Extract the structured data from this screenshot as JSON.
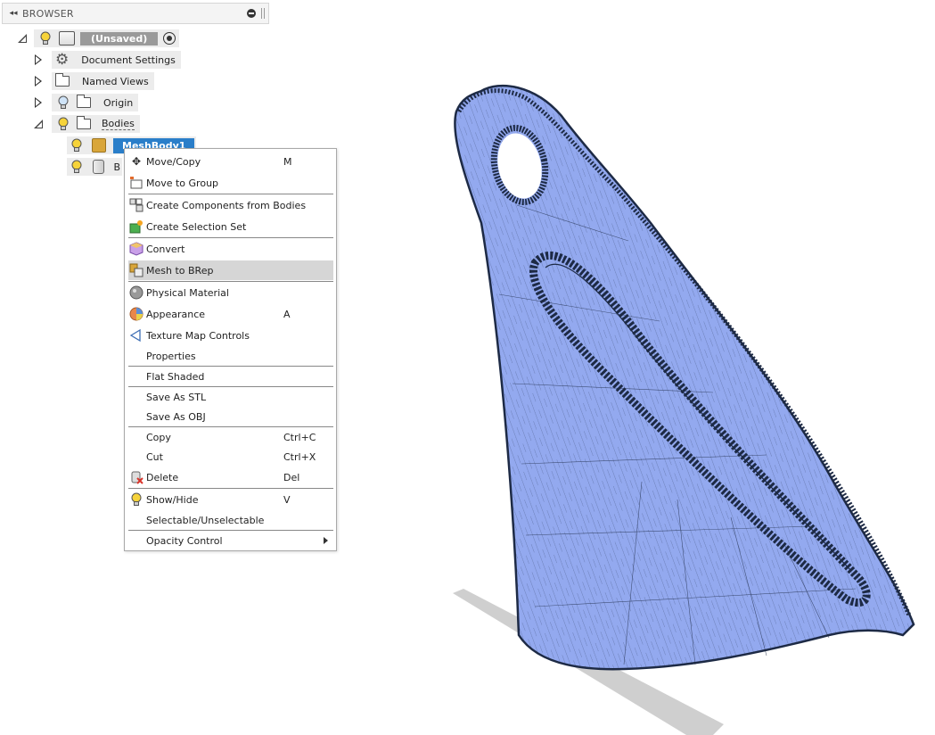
{
  "browser": {
    "title": "BROWSER",
    "collapse_icon": "double-chevron-left-icon"
  },
  "tree": {
    "root_label": "(Unsaved)",
    "document_settings": "Document Settings",
    "named_views": "Named Views",
    "origin": "Origin",
    "bodies": "Bodies",
    "mesh_body": "MeshBody1",
    "body2_partial": "B"
  },
  "context_menu": {
    "items": [
      {
        "label": "Move/Copy",
        "shortcut": "M",
        "icon": "move-arrows-icon"
      },
      {
        "label": "Move to Group",
        "shortcut": "",
        "icon": "move-group-icon"
      },
      {
        "label": "Create Components from Bodies",
        "shortcut": "",
        "icon": "components-icon"
      },
      {
        "label": "Create Selection Set",
        "shortcut": "",
        "icon": "selection-set-icon"
      },
      {
        "label": "Convert",
        "shortcut": "",
        "icon": "convert-cube-icon"
      },
      {
        "label": "Mesh to BRep",
        "shortcut": "",
        "icon": "mesh-to-brep-icon"
      },
      {
        "label": "Physical Material",
        "shortcut": "",
        "icon": "material-sphere-icon"
      },
      {
        "label": "Appearance",
        "shortcut": "A",
        "icon": "appearance-sphere-icon"
      },
      {
        "label": "Texture Map Controls",
        "shortcut": "",
        "icon": "texture-map-icon"
      },
      {
        "label": "Properties",
        "shortcut": "",
        "icon": ""
      },
      {
        "label": "Flat Shaded",
        "shortcut": "",
        "icon": ""
      },
      {
        "label": "Save As STL",
        "shortcut": "",
        "icon": ""
      },
      {
        "label": "Save As OBJ",
        "shortcut": "",
        "icon": ""
      },
      {
        "label": "Copy",
        "shortcut": "Ctrl+C",
        "icon": ""
      },
      {
        "label": "Cut",
        "shortcut": "Ctrl+X",
        "icon": ""
      },
      {
        "label": "Delete",
        "shortcut": "Del",
        "icon": "delete-icon"
      },
      {
        "label": "Show/Hide",
        "shortcut": "V",
        "icon": "lightbulb-icon"
      },
      {
        "label": "Selectable/Unselectable",
        "shortcut": "",
        "icon": ""
      },
      {
        "label": "Opacity Control",
        "shortcut": "",
        "icon": ""
      }
    ],
    "highlighted": "Mesh to BRep"
  },
  "colors": {
    "mesh_fill": "#93a9ef",
    "mesh_edge": "#1d2a45",
    "selection_blue": "#2a7ec9",
    "highlight_gray": "#d6d6d6"
  }
}
